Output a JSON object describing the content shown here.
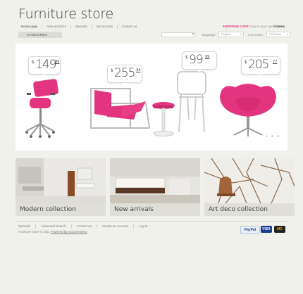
{
  "header": {
    "logo": "Furniture store",
    "nav": [
      "Home page",
      "New products",
      "Specials",
      "My account",
      "Contact us"
    ],
    "cart_title": "SHOPPING CART:",
    "cart_text": "now in your cart",
    "cart_count": "0 items"
  },
  "toolbar": {
    "categories_label": "CATEGORIES",
    "search_placeholder": "",
    "search_button": "»",
    "language_label": "language:",
    "language_value": "English",
    "currencies_label": "currencies:",
    "currency_value": "US Dollar"
  },
  "hero": {
    "prices": [
      {
        "currency": "$",
        "whole": "149",
        "cents": "99"
      },
      {
        "currency": "$",
        "whole": "255",
        "cents": "34"
      },
      {
        "currency": "$",
        "whole": "99",
        "cents": "99"
      },
      {
        "currency": "$",
        "whole": "205",
        "cents": "77"
      }
    ],
    "slides": [
      "1",
      "2",
      "3"
    ]
  },
  "collections": [
    {
      "title": "Modern collection"
    },
    {
      "title": "New arrivals"
    },
    {
      "title": "Art deco collection"
    }
  ],
  "footer": {
    "nav": [
      "Specials",
      "Advanced Search",
      "Contact us",
      "Create an Account",
      "Log In"
    ],
    "copyright": "Furniture store © 2011",
    "powered": "Powered by osCommerce",
    "payments": [
      "PayPal",
      "VISA",
      "MC"
    ]
  },
  "colors": {
    "accent": "#e0357a",
    "chair_pink": "#e3357f",
    "background": "#f1f1ec"
  }
}
